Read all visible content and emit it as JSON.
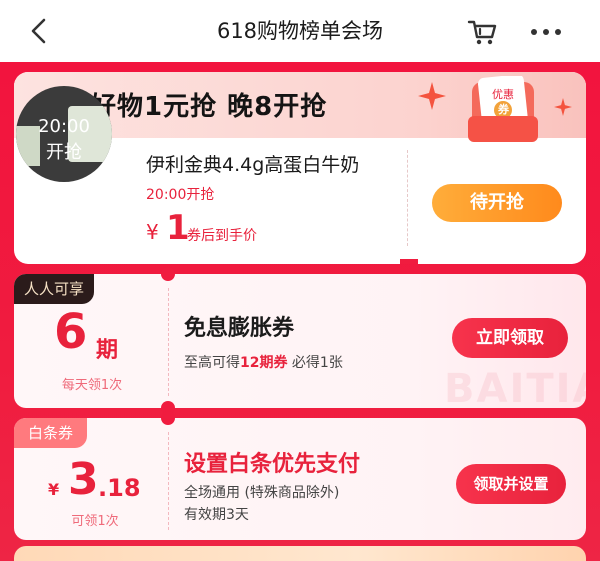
{
  "header": {
    "title": "618购物榜单会场",
    "back_icon": "chevron-left-icon",
    "cart_icon": "shopping-cart-icon",
    "more_icon": "more-dots-icon"
  },
  "flash_sale": {
    "title": "大牌好物1元抢 晚8开抢",
    "art_text": "优惠",
    "art_sub": "券",
    "product": {
      "image_time": "20:00",
      "image_caption": "开抢",
      "name": "伊利金典4.4g高蛋白牛奶",
      "start_time": "20:00开抢",
      "currency": "¥",
      "price": "1",
      "price_note": "券后到手价"
    },
    "button_label": "待开抢"
  },
  "coupons": [
    {
      "tag": "人人可享",
      "amount": "6",
      "unit": "期",
      "limit": "每天领1次",
      "title": "免息膨胀券",
      "desc_prefix": "至高可得",
      "desc_highlight": "12期券",
      "desc_suffix": " 必得1张",
      "watermark": "BAITIAO",
      "button_label": "立即领取"
    },
    {
      "tag": "白条券",
      "currency": "¥",
      "amount_int": "3",
      "amount_dec": ".18",
      "limit": "可领1次",
      "title": "设置白条优先支付",
      "desc_line1": "全场通用 (特殊商品除外)",
      "desc_line2": "有效期3天",
      "button_label": "领取并设置"
    }
  ],
  "colors": {
    "primary_red": "#e8223c",
    "background_red": "#f01c3f",
    "wait_orange": "#ff8a1c"
  }
}
